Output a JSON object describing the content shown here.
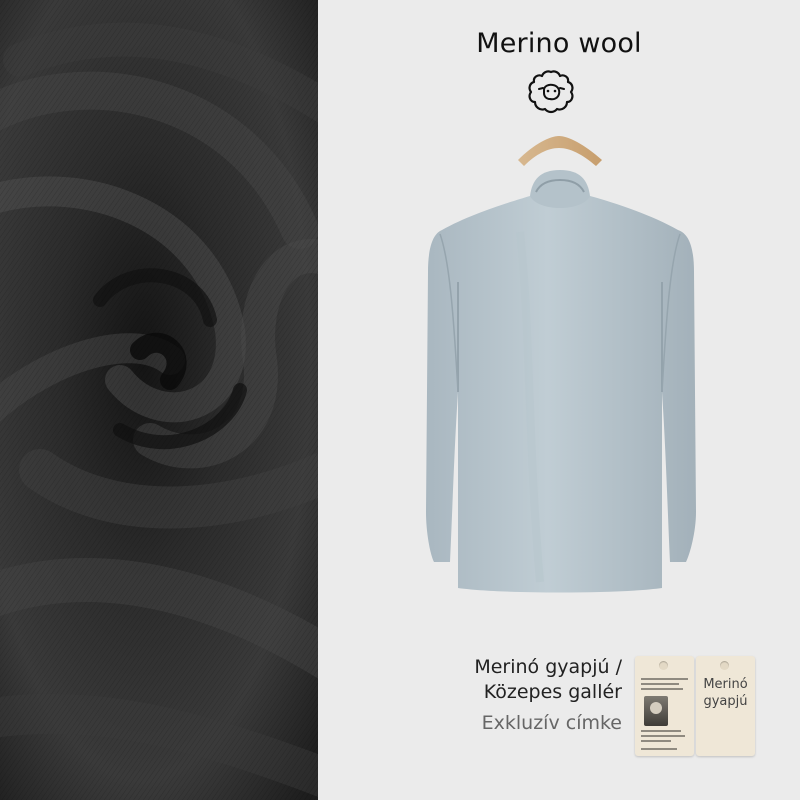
{
  "header": {
    "title": "Merino wool",
    "icon": "sheep-icon"
  },
  "product": {
    "name": "mock-neck long-sleeve top",
    "color": "#b7c4cc"
  },
  "caption": {
    "line1": "Merinó gyapjú /",
    "line2": "Közepes gallér",
    "line3": "Exkluzív címke"
  },
  "tags": {
    "tag_b_line1": "Merinó",
    "tag_b_line2": "gyapjú"
  },
  "colors": {
    "fabric": "#222222",
    "background": "#ebebeb",
    "tag": "#efe7d7"
  }
}
